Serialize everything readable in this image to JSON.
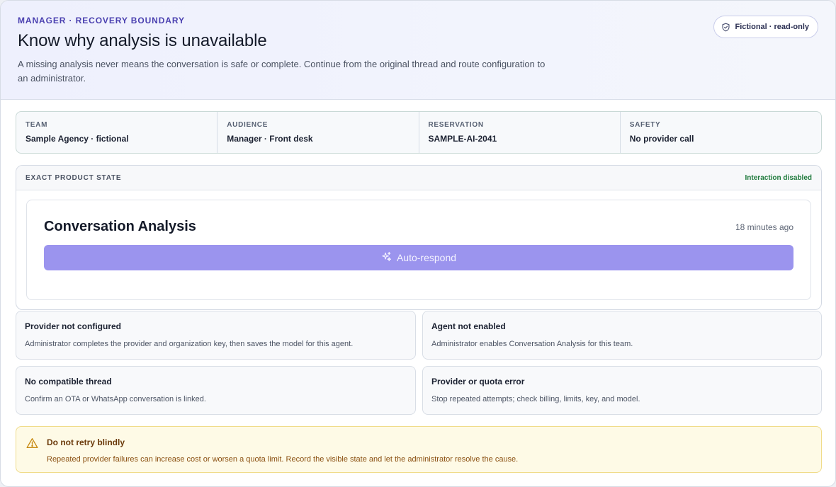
{
  "header": {
    "eyebrow": "MANAGER · RECOVERY BOUNDARY",
    "title": "Know why analysis is unavailable",
    "lede": "A missing analysis never means the conversation is safe or complete. Continue from the original thread and route configuration to an administrator.",
    "badge": {
      "label": "Fictional · read-only",
      "icon": "shield-icon"
    }
  },
  "meta": [
    {
      "label": "TEAM",
      "value": "Sample Agency · fictional"
    },
    {
      "label": "AUDIENCE",
      "value": "Manager · Front desk"
    },
    {
      "label": "RESERVATION",
      "value": "SAMPLE-AI-2041"
    },
    {
      "label": "SAFETY",
      "value": "No provider call"
    }
  ],
  "state": {
    "label": "EXACT PRODUCT STATE",
    "flag": "Interaction disabled",
    "card": {
      "title": "Conversation Analysis",
      "time": "18 minutes ago",
      "button_label": "Auto-respond",
      "button_icon": "sparkles-icon"
    }
  },
  "causes": [
    {
      "title": "Provider not configured",
      "body": "Administrator completes the provider and organization key, then saves the model for this agent."
    },
    {
      "title": "Agent not enabled",
      "body": "Administrator enables Conversation Analysis for this team."
    },
    {
      "title": "No compatible thread",
      "body": "Confirm an OTA or WhatsApp conversation is linked."
    },
    {
      "title": "Provider or quota error",
      "body": "Stop repeated attempts; check billing, limits, key, and model."
    }
  ],
  "warning": {
    "icon": "warning-triangle-icon",
    "title": "Do not retry blindly",
    "body": "Repeated provider failures can increase cost or worsen a quota limit. Record the visible state and let the administrator resolve the cause."
  },
  "colors": {
    "accent": "#4a40b0",
    "button": "#9b94ee",
    "success": "#1f7a3c",
    "warning_bg": "#fefae6",
    "warning_text": "#6b3a0b"
  }
}
